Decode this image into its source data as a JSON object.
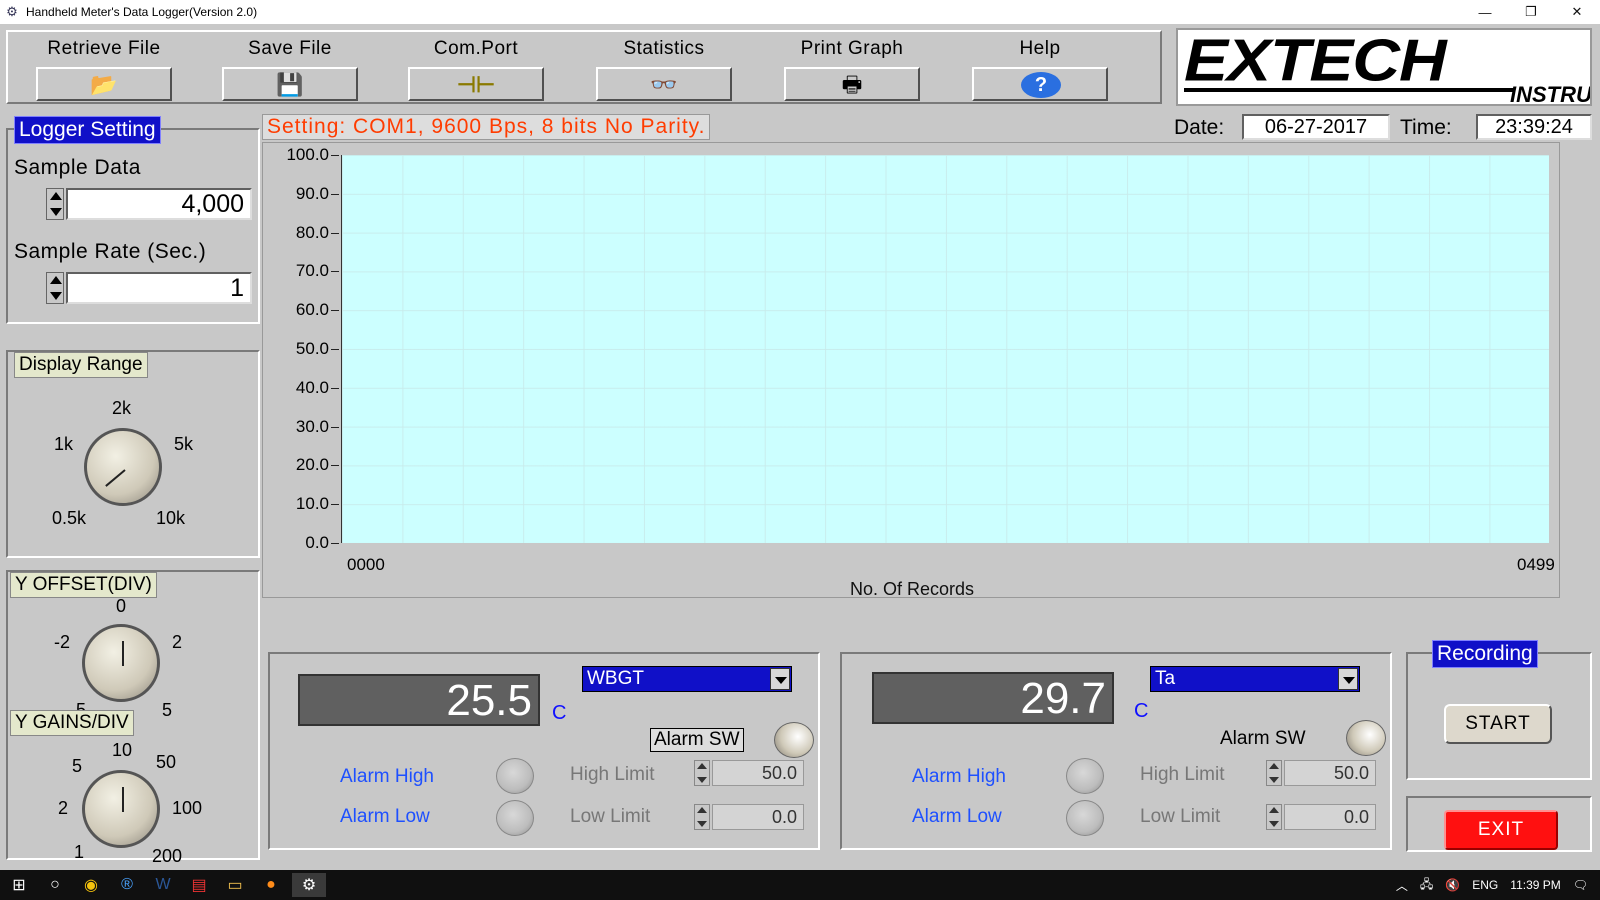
{
  "window": {
    "title": "Handheld Meter's Data Logger(Version 2.0)",
    "minimize": "—",
    "restore": "❐",
    "close": "✕"
  },
  "toolbar": {
    "items": [
      {
        "label": "Retrieve File",
        "icon": "open-folder-icon",
        "glyph": "📂"
      },
      {
        "label": "Save File",
        "icon": "floppy-disk-icon",
        "glyph": "💾"
      },
      {
        "label": "Com.Port",
        "icon": "com-port-icon",
        "glyph": "⊣⊢"
      },
      {
        "label": "Statistics",
        "icon": "glasses-icon",
        "glyph": "👓"
      },
      {
        "label": "Print Graph",
        "icon": "printer-icon",
        "glyph": "🖶"
      },
      {
        "label": "Help",
        "icon": "help-icon",
        "glyph": "?"
      }
    ]
  },
  "logo": {
    "brand": "EXTECH",
    "sub": "INSTRUMENTS"
  },
  "logger_setting": {
    "title": "Logger Setting",
    "sample_data_label": "Sample Data",
    "sample_data_value": "4,000",
    "sample_rate_label": "Sample Rate (Sec.)",
    "sample_rate_value": "1"
  },
  "display_range": {
    "title": "Display Range",
    "labels": [
      "0.5k",
      "1k",
      "2k",
      "5k",
      "10k"
    ]
  },
  "y_offset": {
    "title": "Y OFFSET(DIV)",
    "labels": [
      "-5",
      "-2",
      "0",
      "2",
      "5"
    ]
  },
  "y_gains": {
    "title": "Y GAINS/DIV",
    "labels": [
      "1",
      "2",
      "5",
      "10",
      "50",
      "100",
      "200"
    ]
  },
  "status": {
    "setting": "Setting: COM1, 9600 Bps, 8 bits No Parity."
  },
  "datetime": {
    "date_label": "Date:",
    "date_value": "06-27-2017",
    "time_label": "Time:",
    "time_value": "23:39:24"
  },
  "chart_data": {
    "type": "line",
    "x": [],
    "series": [],
    "xlabel": "No. Of Records",
    "x_ticks": [
      "0000",
      "0499"
    ],
    "y_ticks": [
      "100.0",
      "90.0",
      "80.0",
      "70.0",
      "60.0",
      "50.0",
      "40.0",
      "30.0",
      "20.0",
      "10.0",
      "0.0"
    ],
    "ylim": [
      0,
      100
    ],
    "xlim": [
      0,
      499
    ],
    "grid": true,
    "background": "#ccffff"
  },
  "channel1": {
    "value": "25.5",
    "unit": "C",
    "selected": "WBGT",
    "alarm_sw": "Alarm SW",
    "alarm_high": "Alarm High",
    "alarm_low": "Alarm Low",
    "high_limit_label": "High Limit",
    "high_limit_value": "50.0",
    "low_limit_label": "Low Limit",
    "low_limit_value": "0.0"
  },
  "channel2": {
    "value": "29.7",
    "unit": "C",
    "selected": "Ta",
    "alarm_sw": "Alarm SW",
    "alarm_high": "Alarm High",
    "alarm_low": "Alarm Low",
    "high_limit_label": "High Limit",
    "high_limit_value": "50.0",
    "low_limit_label": "Low Limit",
    "low_limit_value": "0.0"
  },
  "recording": {
    "title": "Recording",
    "start": "START"
  },
  "exit": {
    "label": "EXIT"
  },
  "taskbar": {
    "lang": "ENG",
    "clock": "11:39 PM",
    "items": [
      "windows-start-icon",
      "cortana-icon",
      "chrome-icon",
      "app-r-icon",
      "word-icon",
      "pdf-icon",
      "file-explorer-icon",
      "firefox-icon",
      "data-logger-icon"
    ]
  },
  "colors": {
    "accent_blue": "#1010c8",
    "status_red": "#ff3c00",
    "exit_red": "#ff1010",
    "plot_bg": "#ccffff",
    "alarm_blue": "#1e50ff"
  }
}
